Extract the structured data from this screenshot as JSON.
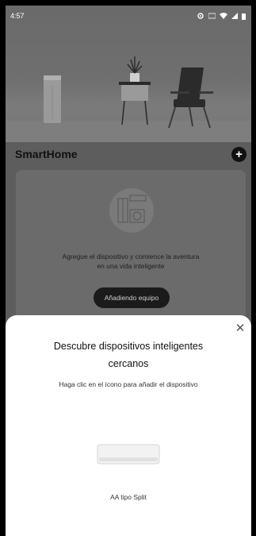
{
  "status_bar": {
    "time": "4:57"
  },
  "home": {
    "title": "SmartHome",
    "add_icon": "plus-icon"
  },
  "empty_state": {
    "message_line1": "Agregue el dispositivo y comience la aventura",
    "message_line2": "en una vida inteligente",
    "button_label": "Añadiendo equipo"
  },
  "discover_sheet": {
    "title_line1": "Descubre dispositivos inteligentes",
    "title_line2": "cercanos",
    "subtitle": "Haga clic en el ícono para añadir el dispositivo",
    "close_icon": "close-icon",
    "devices": [
      {
        "label": "AA tipo Split",
        "icon": "split-air-conditioner"
      }
    ]
  },
  "colors": {
    "overlay": "#5d5d5d",
    "button_dark": "#1b1b1b",
    "sheet_background": "#ffffff"
  }
}
